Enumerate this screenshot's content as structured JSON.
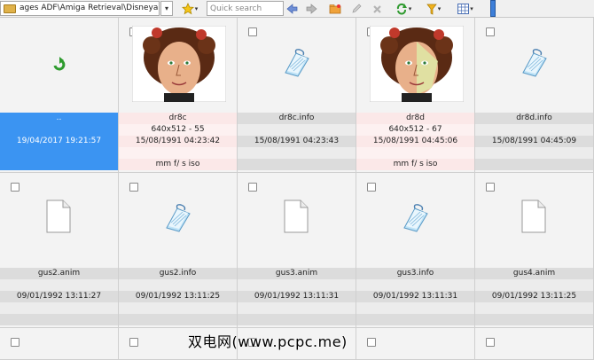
{
  "toolbar": {
    "path": "ages ADF\\Amiga Retrieval\\Disneyart\\",
    "search_placeholder": "Quick search"
  },
  "grid": {
    "cells": [
      {
        "name": "..",
        "dims": "",
        "date": "19/04/2017 19:21:57",
        "extra": "",
        "kind": "up",
        "selected": true
      },
      {
        "name": "dr8c",
        "dims": "640x512 - 55",
        "date": "15/08/1991 04:23:42",
        "extra": "mm f/ s iso",
        "kind": "picture"
      },
      {
        "name": "dr8c.info",
        "dims": "",
        "date": "15/08/1991 04:23:43",
        "extra": "",
        "kind": "info"
      },
      {
        "name": "dr8d",
        "dims": "640x512 - 67",
        "date": "15/08/1991 04:45:06",
        "extra": "mm f/ s iso",
        "kind": "picture"
      },
      {
        "name": "dr8d.info",
        "dims": "",
        "date": "15/08/1991 04:45:09",
        "extra": "",
        "kind": "info"
      },
      {
        "name": "gus2.anim",
        "dims": "",
        "date": "09/01/1992 13:11:27",
        "extra": "",
        "kind": "doc"
      },
      {
        "name": "gus2.info",
        "dims": "",
        "date": "09/01/1992 13:11:25",
        "extra": "",
        "kind": "info"
      },
      {
        "name": "gus3.anim",
        "dims": "",
        "date": "09/01/1992 13:11:31",
        "extra": "",
        "kind": "doc"
      },
      {
        "name": "gus3.info",
        "dims": "",
        "date": "09/01/1992 13:11:31",
        "extra": "",
        "kind": "info"
      },
      {
        "name": "gus4.anim",
        "dims": "",
        "date": "09/01/1992 13:11:25",
        "extra": "",
        "kind": "doc"
      }
    ]
  },
  "watermark": "双电网(www.pcpc.me)",
  "colors": {
    "selection": "#3b94f2",
    "picture_tint": "#fbe8e8",
    "slider": "#3d7fd9"
  }
}
